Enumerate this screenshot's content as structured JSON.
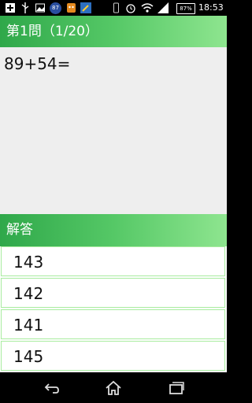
{
  "status_bar": {
    "time": "18:53",
    "battery": "87%",
    "badge": "87",
    "icons": [
      "plus-icon",
      "usb-icon",
      "image-icon",
      "badge-icon",
      "android-icon",
      "tool-icon",
      "vibrate-icon",
      "alarm-icon",
      "wifi-icon",
      "signal-icon",
      "battery-icon"
    ]
  },
  "header": {
    "title": "第1問（1/20）"
  },
  "question": {
    "text": "89+54="
  },
  "answer_section": {
    "title": "解答"
  },
  "options": [
    "143",
    "142",
    "141",
    "145"
  ],
  "colors": {
    "accent_start": "#2fa84a",
    "accent_end": "#8ee58f",
    "option_border": "#a8ec9f",
    "question_bg": "#eeeeee"
  },
  "navigation": {
    "buttons": [
      "back-icon",
      "home-icon",
      "recent-apps-icon"
    ]
  }
}
